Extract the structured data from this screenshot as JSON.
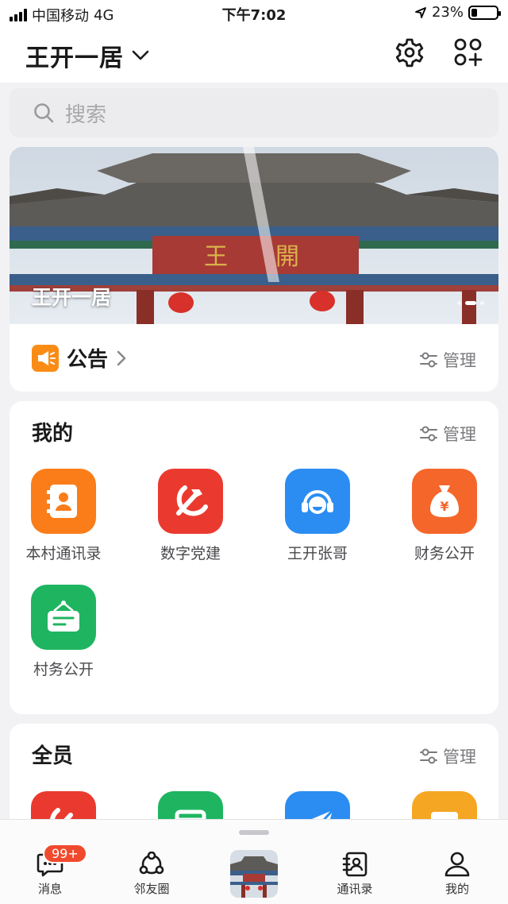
{
  "status_bar": {
    "carrier": "中国移动",
    "network": "4G",
    "time": "下午7:02",
    "battery": "23%",
    "battery_level": 0.23
  },
  "header": {
    "title": "王开一居",
    "title_icon": "chevron-down-icon",
    "actions": [
      "gear-icon",
      "apps-add-icon"
    ]
  },
  "search": {
    "placeholder": "搜索",
    "icon": "search-icon"
  },
  "banner": {
    "title": "王开一居",
    "slide_count": 3,
    "active_slide": 2
  },
  "notice": {
    "label": "公告",
    "icon": "megaphone-icon",
    "manage_label": "管理"
  },
  "mine": {
    "title": "我的",
    "manage_label": "管理",
    "items": [
      {
        "label": "本村通讯录",
        "icon": "contact-book-icon",
        "color": "#fa7d1a"
      },
      {
        "label": "数字党建",
        "icon": "party-emblem-icon",
        "color": "#ea3a2f"
      },
      {
        "label": "王开张哥",
        "icon": "headset-icon",
        "color": "#2b8df2"
      },
      {
        "label": "财务公开",
        "icon": "money-bag-icon",
        "color": "#f5662a"
      },
      {
        "label": "村务公开",
        "icon": "notice-board-icon",
        "color": "#1fb560"
      }
    ]
  },
  "all": {
    "title": "全员",
    "manage_label": "管理",
    "partial_icons": [
      {
        "icon": "party-emblem-icon",
        "color": "#ea3a2f"
      },
      {
        "icon": "calendar-icon",
        "color": "#1fb560"
      },
      {
        "icon": "send-icon",
        "color": "#2b8df2"
      },
      {
        "icon": "image-icon",
        "color": "#f5a623"
      }
    ]
  },
  "tabbar": {
    "tabs": [
      {
        "label": "消息",
        "icon": "chat-icon"
      },
      {
        "label": "邻友圈",
        "icon": "circle-share-icon"
      },
      {
        "label": "",
        "icon": "home-photo-icon"
      },
      {
        "label": "通讯录",
        "icon": "address-book-icon"
      },
      {
        "label": "我的",
        "icon": "person-icon"
      }
    ],
    "message_badge": "99+"
  },
  "colors": {
    "accent_orange": "#fa8c16",
    "badge_red": "#f04a2e"
  }
}
